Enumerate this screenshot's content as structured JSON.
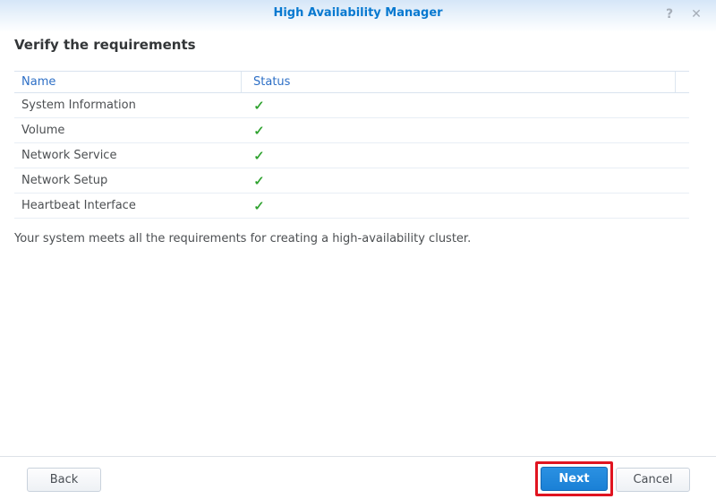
{
  "window": {
    "title": "High Availability Manager",
    "help_icon": "?",
    "close_icon": "✕"
  },
  "page": {
    "heading": "Verify the requirements",
    "note": "Your system meets all the requirements for creating a high-availability cluster."
  },
  "table": {
    "columns": [
      "Name",
      "Status"
    ],
    "status_pass_glyph": "✓",
    "rows": [
      {
        "name": "System Information",
        "status": "pass"
      },
      {
        "name": "Volume",
        "status": "pass"
      },
      {
        "name": "Network Service",
        "status": "pass"
      },
      {
        "name": "Network Setup",
        "status": "pass"
      },
      {
        "name": "Heartbeat Interface",
        "status": "pass"
      }
    ]
  },
  "footer": {
    "back_label": "Back",
    "next_label": "Next",
    "cancel_label": "Cancel"
  },
  "colors": {
    "title_blue": "#0879d0",
    "column_header_blue": "#2d6fc6",
    "check_green": "#2ea22e",
    "primary_button_blue": "#1d87de",
    "annotation_red": "#e01420"
  },
  "annotation": {
    "type": "highlight-box",
    "target": "next-button"
  }
}
